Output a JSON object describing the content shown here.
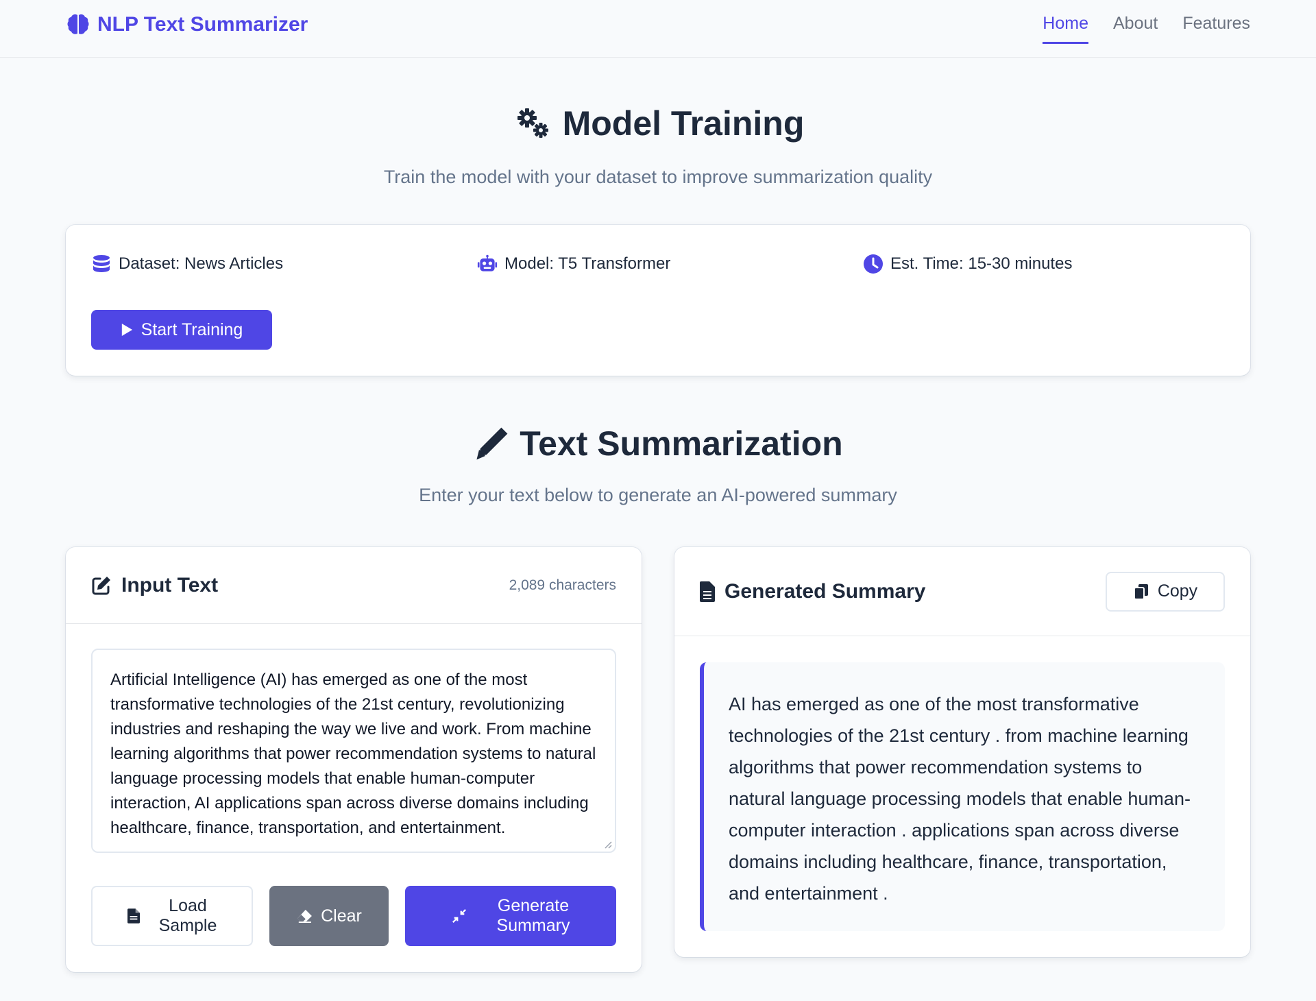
{
  "nav": {
    "brand": "NLP Text Summarizer",
    "links": [
      "Home",
      "About",
      "Features"
    ],
    "active": "Home"
  },
  "training": {
    "title": "Model Training",
    "subtitle": "Train the model with your dataset to improve summarization quality",
    "dataset": "Dataset: News Articles",
    "model": "Model: T5 Transformer",
    "time": "Est. Time: 15-30 minutes",
    "button": "Start Training"
  },
  "summarization": {
    "title": "Text Summarization",
    "subtitle": "Enter your text below to generate an AI-powered summary"
  },
  "input_panel": {
    "title": "Input Text",
    "char_count": "2,089 characters",
    "text": "Artificial Intelligence (AI) has emerged as one of the most transformative technologies of the 21st century, revolutionizing industries and reshaping the way we live and work. From machine learning algorithms that power recommendation systems to natural language processing models that enable human-computer interaction, AI applications span across diverse domains including healthcare, finance, transportation, and entertainment.",
    "load_sample": "Load Sample",
    "clear": "Clear",
    "generate": "Generate Summary"
  },
  "summary_panel": {
    "title": "Generated Summary",
    "copy": "Copy",
    "text": "AI has emerged as one of the most transformative technologies of the 21st century . from machine learning algorithms that power recommendation systems to natural language processing models that enable human-computer interaction . applications span across diverse domains including healthcare, finance, transportation, and entertainment ."
  },
  "colors": {
    "accent": "#4f46e5",
    "text": "#1e293b",
    "muted": "#64748b",
    "gray_button": "#6b7280",
    "background": "#f8fafc"
  },
  "icons": {
    "brand": "brain-icon",
    "training": "gears-icon",
    "dataset": "database-icon",
    "model": "robot-icon",
    "time": "clock-icon",
    "start": "play-icon",
    "summarization": "pen-icon",
    "input": "edit-icon",
    "load": "file-icon",
    "clear": "eraser-icon",
    "generate": "compress-icon",
    "summary": "document-icon",
    "copy": "copy-icon"
  }
}
